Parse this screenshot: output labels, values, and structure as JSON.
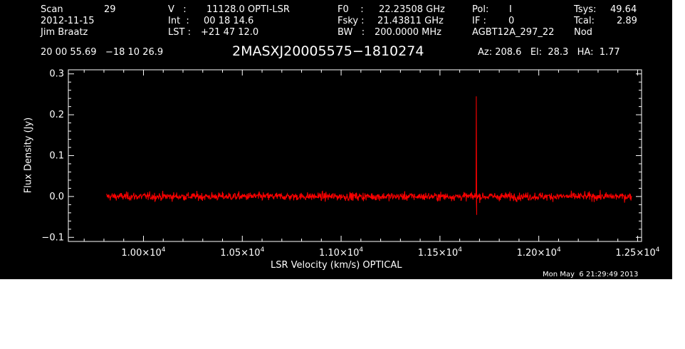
{
  "header": {
    "scan_label": "Scan",
    "scan_value": "29",
    "date": "2012-11-15",
    "observer": "Jim Braatz",
    "v_label": "V   :",
    "v_value": "11128.0 OPTI-LSR",
    "int_label": "Int  :",
    "int_value": "00 18 14.6",
    "lst_label": "LST :",
    "lst_value": "+21 47 12.0",
    "f0_label": "F0    :",
    "f0_value": "22.23508 GHz",
    "fsky_label": "Fsky :",
    "fsky_value": "21.43811 GHz",
    "bw_label": "BW   :",
    "bw_value": "200.0000 MHz",
    "pol_label": "Pol:",
    "pol_value": "I",
    "if_label": "IF :",
    "if_value": "0",
    "project": "AGBT12A_297_22",
    "tsys_label": "Tsys:",
    "tsys_value": "49.64",
    "tcal_label": "Tcal:",
    "tcal_value": "2.89",
    "procedure": "Nod",
    "coords": "20 00 55.69   −18 10 26.9",
    "source": "2MASXJ20005575−1810274",
    "az_el_ha": "Az: 208.6   El:  28.3   HA:  1.77"
  },
  "footer": {
    "timestamp": "Mon May  6 21:29:49 2013"
  },
  "colors": {
    "background": "#000000",
    "axes": "#ffffff",
    "trace": "#ff0000"
  },
  "chart_data": {
    "type": "line",
    "xlabel": "LSR Velocity (km/s) OPTICAL",
    "ylabel": "Flux Density (Jy)",
    "xlim": [
      9620,
      12520
    ],
    "ylim": [
      -0.11,
      0.31
    ],
    "x_ticks": [
      10000,
      10500,
      11000,
      11500,
      12000,
      12500
    ],
    "x_tick_labels": [
      {
        "mantissa": "1.00×10",
        "exp": "4"
      },
      {
        "mantissa": "1.05×10",
        "exp": "4"
      },
      {
        "mantissa": "1.10×10",
        "exp": "4"
      },
      {
        "mantissa": "1.15×10",
        "exp": "4"
      },
      {
        "mantissa": "1.20×10",
        "exp": "4"
      },
      {
        "mantissa": "1.25×10",
        "exp": "4"
      }
    ],
    "y_ticks": [
      -0.1,
      0.0,
      0.1,
      0.2,
      0.3
    ],
    "y_tick_labels": [
      "−0.1",
      "0.0",
      "0.1",
      "0.2",
      "0.3"
    ],
    "grid": false,
    "series": [
      {
        "x_range": [
          9813,
          12470
        ],
        "baseline": 0.0,
        "noise_rms": 0.005,
        "spike": {
          "x": 11684,
          "peak": 0.245,
          "trough": -0.045
        },
        "color": "#ff0000"
      }
    ]
  }
}
